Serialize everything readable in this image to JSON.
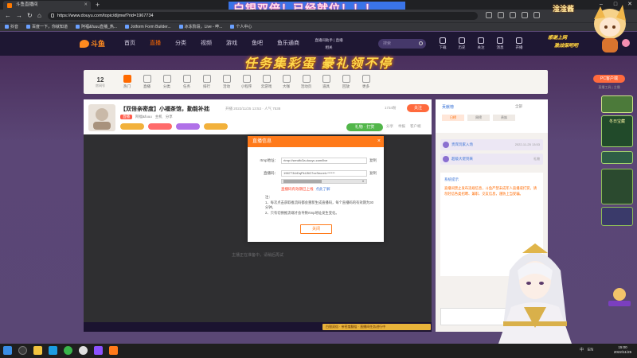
{
  "banner_text": "白银双倍！已经就位！！！",
  "browser": {
    "tab_title": "斗鱼直播间",
    "url": "https://www.douyu.com/topic/dljmwf?rid=1967734",
    "bookmarks": [
      "抖音",
      "百度一下，你就知道",
      "阿福&fuuu直播_热...",
      "Jotform Form Builder...",
      "冰冻阶段，Live - 哔...",
      "个人中心"
    ]
  },
  "site": {
    "logo": "斗鱼",
    "nav": [
      "首页",
      "直播",
      "分类",
      "视频",
      "游戏",
      "鱼吧",
      "鱼乐通商"
    ],
    "help": "直播间助手 | 直播相关",
    "search_placeholder": "搜索",
    "icons": [
      "下载",
      "历史",
      "关注",
      "消息",
      "开播"
    ]
  },
  "promo_slogan": "任务集彩蛋 豪礼领不停",
  "room_bar": {
    "room_number": "12",
    "room_label": "房间号",
    "tabs": [
      "热门",
      "直播",
      "分类",
      "任务",
      "排行",
      "活动",
      "小程序",
      "云游戏",
      "大咖",
      "活动页",
      "道具",
      "回放",
      "更多"
    ],
    "pc_button": "PC客户端",
    "pc_sub": "直播工具 | 主播"
  },
  "room_info": {
    "title": "【双倍亲密度】小福茶馆，勤能补拙",
    "meta": "开播 2022/11/25  13:53  · 人气 7538",
    "categories": [
      "直播",
      "阿福&fuuu",
      "主机",
      "分享"
    ],
    "follow_count": "1734粉",
    "follow_button": "关注",
    "gift_button": "礼物 · 打赏",
    "tools": [
      "分享",
      "举报",
      "客户端"
    ]
  },
  "video": {
    "hint": "主播正在准备中，请稍后再试"
  },
  "gift_strip": {
    "message": "白银双倍 · 亲密度翻倍 · 直播间任务进行中"
  },
  "modal": {
    "title": "直播信息",
    "rtmp_label": "rtmp地址：",
    "rtmp_value": "rtmp://sendfc3a.douyu.com/live",
    "code_label": "直播码：",
    "code_value": "1967734rDqPkIJ5G7xxSecret=******",
    "copy_label": "复制",
    "mask_caret": "▾",
    "regen_red": "直播码有效期已上线",
    "regen_blue": "点此了解",
    "note_title": "注：",
    "notes": [
      "1、每次点击获取推流码都会重新生成直播码，每个直播码的有效期为30分钟。",
      "2、只有切换推流端才会导致rtmp地址发生变化。"
    ],
    "ok_button": "关闭"
  },
  "chat": {
    "rank_title": "贡献榜",
    "rank_more": "全部",
    "rank_tabs": [
      "日榜",
      "周榜",
      "贵族"
    ],
    "feeds": [
      {
        "name": "贵宾玩家入场",
        "time": "2022-11-25 13:53"
      },
      {
        "name": "超级大佬到来",
        "time": "礼物"
      }
    ],
    "system": "系统提示",
    "system_text": "直播间禁止发布违规信息，斗鱼严禁未成年人直播或打赏，请勿轻信各类招聘、兼职、交友信息，谨防上当受骗。"
  },
  "overlay": {
    "vtuber_name": "淦淦酱",
    "bubble1": "感谢上网",
    "bubble2": "激战保吧吧"
  },
  "side_promo": {
    "title": "冬日宝藏"
  },
  "taskbar": {
    "tray": [
      "中",
      "EN"
    ],
    "time": "15:00",
    "date": "2022/11/25"
  },
  "colors": {
    "accent": "#ff6a00",
    "modal_header": "#ff7a1a",
    "banner_bg": "#3a74e8"
  }
}
